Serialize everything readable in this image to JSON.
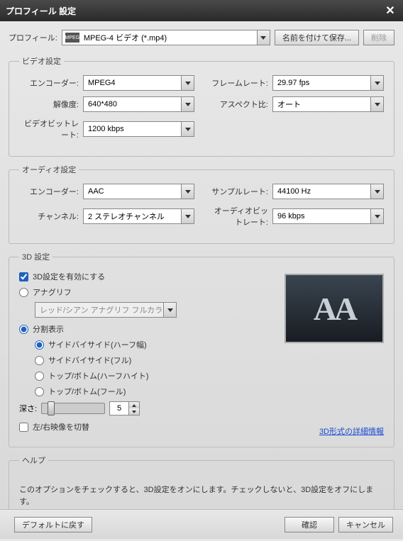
{
  "title": "プロフィール 設定",
  "profile": {
    "label": "プロフィール:",
    "icon": "MPEG",
    "value": "MPEG-4 ビデオ (*.mp4)",
    "save_as": "名前を付けて保存...",
    "delete": "削除"
  },
  "video": {
    "legend": "ビデオ設定",
    "encoder_label": "エンコーダー:",
    "encoder": "MPEG4",
    "framerate_label": "フレームレート:",
    "framerate": "29.97 fps",
    "resolution_label": "解像度:",
    "resolution": "640*480",
    "aspect_label": "アスペクト比:",
    "aspect": "オート",
    "bitrate_label": "ビデオビットレート:",
    "bitrate": "1200 kbps"
  },
  "audio": {
    "legend": "オーディオ設定",
    "encoder_label": "エンコーダー:",
    "encoder": "AAC",
    "samplerate_label": "サンプルレート:",
    "samplerate": "44100 Hz",
    "channel_label": "チャンネル:",
    "channel": "2 ステレオチャンネル",
    "bitrate_label": "オーディオビットレート:",
    "bitrate": "96 kbps"
  },
  "threed": {
    "legend": "3D 設定",
    "enable": "3D設定を有効にする",
    "anaglyph": "アナグリフ",
    "anaglyph_mode": "レッド/シアン アナグリフ フルカラー",
    "split": "分割表示",
    "sbs_half": "サイドバイサイド(ハーフ幅)",
    "sbs_full": "サイドバイサイド(フル)",
    "tb_half": "トップ/ボトム(ハーフハイト)",
    "tb_full": "トップ/ボトム(フール)",
    "depth_label": "深さ:",
    "depth_value": "5",
    "swap": "左/右映像を切替",
    "link": "3D形式の詳細情報",
    "preview_text": "AA"
  },
  "help": {
    "legend": "ヘルプ",
    "text": "このオプションをチェックすると、3D設定をオンにします。チェックしないと、3D設定をオフにします。"
  },
  "footer": {
    "default": "デフォルトに戻す",
    "ok": "確認",
    "cancel": "キャンセル"
  }
}
